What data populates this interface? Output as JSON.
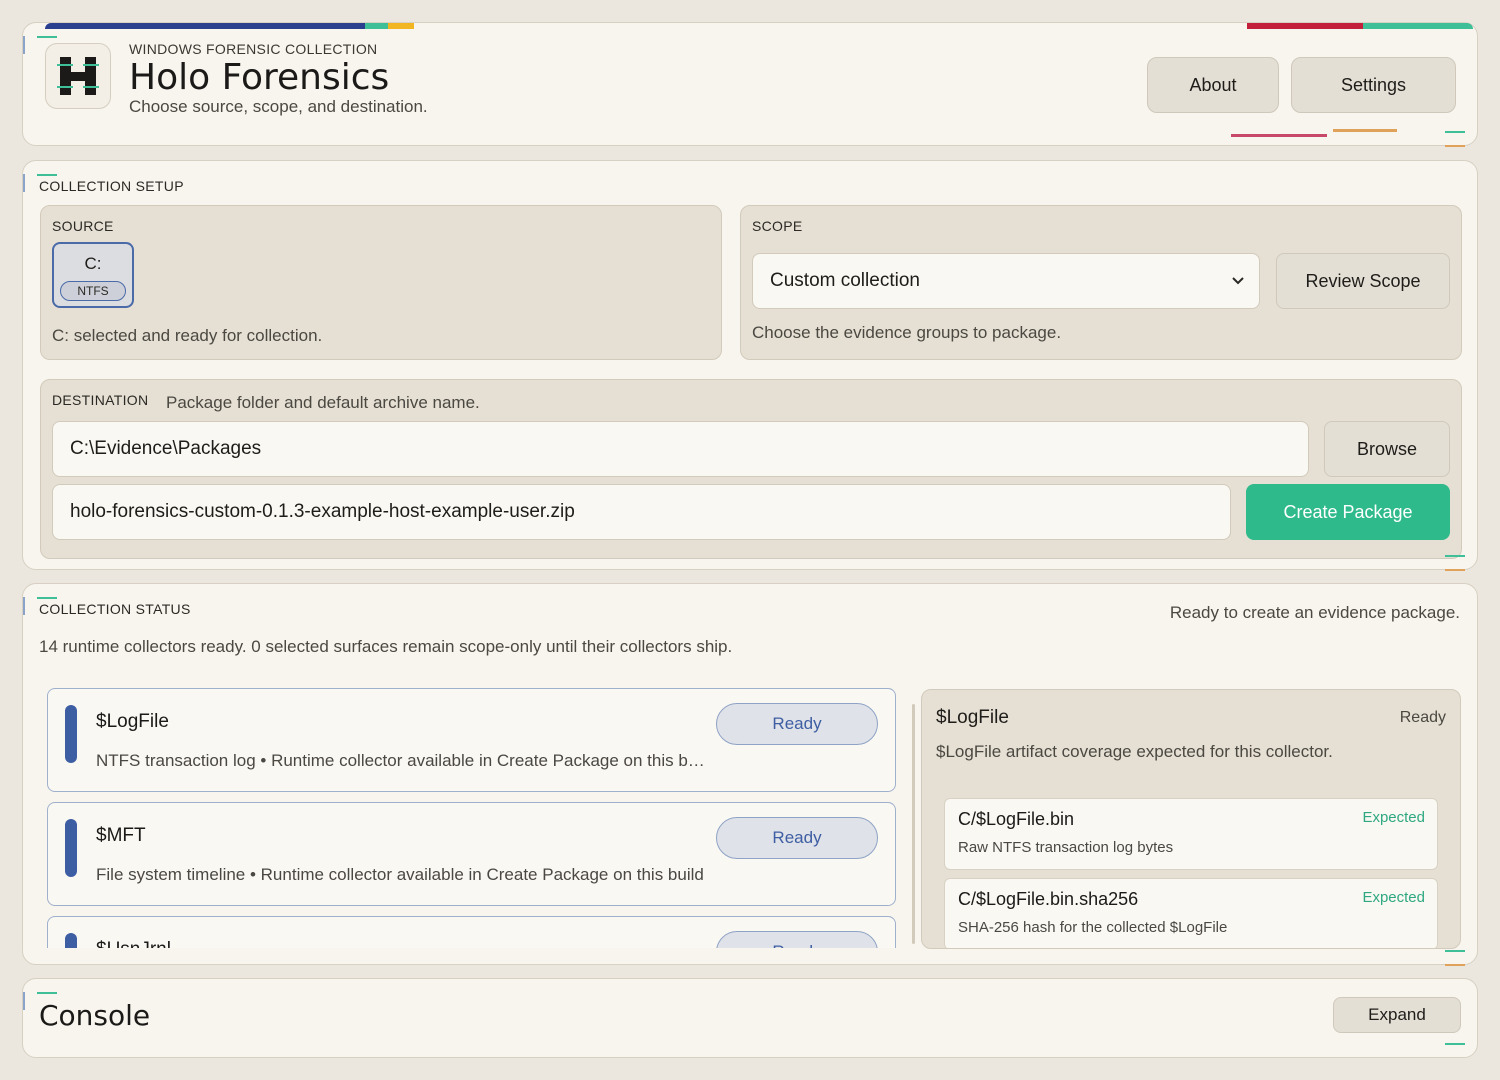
{
  "app": {
    "kicker": "WINDOWS FORENSIC COLLECTION",
    "title": "Holo Forensics",
    "subtitle": "Choose source, scope, and destination.",
    "logo_icon": "holo-h-logo",
    "about_label": "About",
    "settings_label": "Settings",
    "accent_colors": [
      "#2b3f8f",
      "#3fbf98",
      "#f2b622",
      "#c41f3a"
    ]
  },
  "setup": {
    "section_title": "COLLECTION SETUP",
    "source": {
      "label": "SOURCE",
      "drive_letter": "C:",
      "filesystem": "NTFS",
      "status_text": "C: selected and ready for collection."
    },
    "scope": {
      "label": "SCOPE",
      "selected": "Custom collection",
      "review_label": "Review Scope",
      "hint": "Choose the evidence groups to package."
    },
    "destination": {
      "label": "DESTINATION",
      "hint": "Package folder and default archive name.",
      "folder": "C:\\Evidence\\Packages",
      "browse_label": "Browse",
      "archive_name": "holo-forensics-custom-0.1.3-example-host-example-user.zip",
      "create_label": "Create Package"
    }
  },
  "status": {
    "section_title": "COLLECTION STATUS",
    "ready_text": "Ready to create an evidence package.",
    "summary": "14 runtime collectors ready. 0 selected surfaces remain scope-only until their collectors ship.",
    "collectors": [
      {
        "name": "$LogFile",
        "desc": "NTFS transaction log • Runtime collector available in Create Package on this build",
        "badge": "Ready"
      },
      {
        "name": "$MFT",
        "desc": "File system timeline • Runtime collector available in Create Package on this build",
        "badge": "Ready"
      },
      {
        "name": "$UsnJrnl",
        "desc": "",
        "badge": "Ready"
      }
    ],
    "detail": {
      "title": "$LogFile",
      "status": "Ready",
      "desc": "$LogFile artifact coverage expected for this collector.",
      "artifacts": [
        {
          "name": "C/$LogFile.bin",
          "status": "Expected",
          "desc": "Raw NTFS transaction log bytes"
        },
        {
          "name": "C/$LogFile.bin.sha256",
          "status": "Expected",
          "desc": "SHA-256 hash for the collected $LogFile"
        }
      ]
    }
  },
  "console": {
    "title": "Console",
    "expand_label": "Expand"
  }
}
